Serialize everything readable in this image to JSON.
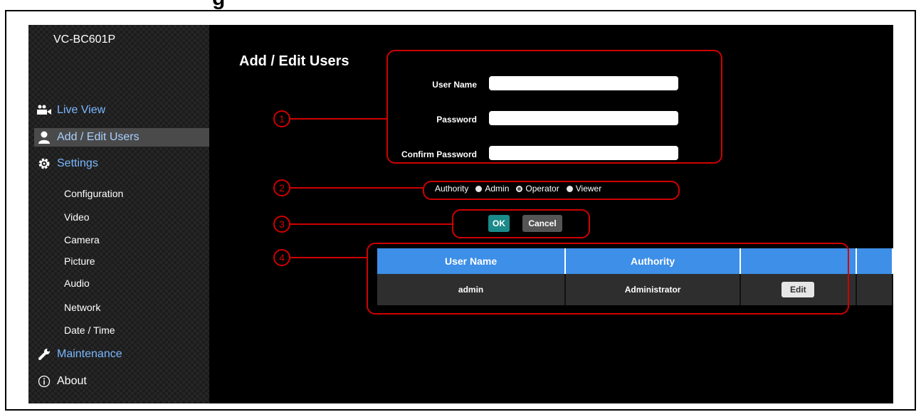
{
  "heading_fragment": "g",
  "sidebar": {
    "model_name": "VC-BC601P",
    "nav": [
      {
        "label": "Live View",
        "icon": "camera-users-icon"
      },
      {
        "label": "Add / Edit Users",
        "icon": "user-icon",
        "active": true
      },
      {
        "label": "Settings",
        "icon": "gear-icon"
      }
    ],
    "settings_items": [
      "Configuration",
      "Video",
      "Camera",
      "Picture",
      "Audio",
      "Network",
      "Date / Time"
    ],
    "maintenance": {
      "label": "Maintenance",
      "icon": "wrench-icon"
    },
    "about": {
      "label": "About",
      "icon": "info-icon"
    }
  },
  "main": {
    "title": "Add / Edit Users",
    "form": {
      "user_name_label": "User Name",
      "password_label": "Password",
      "confirm_password_label": "Confirm Password",
      "user_name_value": "",
      "password_value": "",
      "confirm_password_value": ""
    },
    "authority": {
      "label": "Authority",
      "options": [
        "Admin",
        "Operator",
        "Viewer"
      ],
      "selected": "Operator"
    },
    "buttons": {
      "ok": "OK",
      "cancel": "Cancel"
    },
    "table": {
      "headers": [
        "User Name",
        "Authority",
        "",
        ""
      ],
      "rows": [
        {
          "user_name": "admin",
          "authority": "Administrator",
          "edit_label": "Edit"
        }
      ]
    }
  },
  "callouts": [
    "1",
    "2",
    "3",
    "4"
  ],
  "colors": {
    "callout": "#d00000",
    "table_header": "#3d8fe8",
    "nav_link": "#7bb8ff",
    "ok_button": "#1a8a8a",
    "background": "#000000"
  }
}
